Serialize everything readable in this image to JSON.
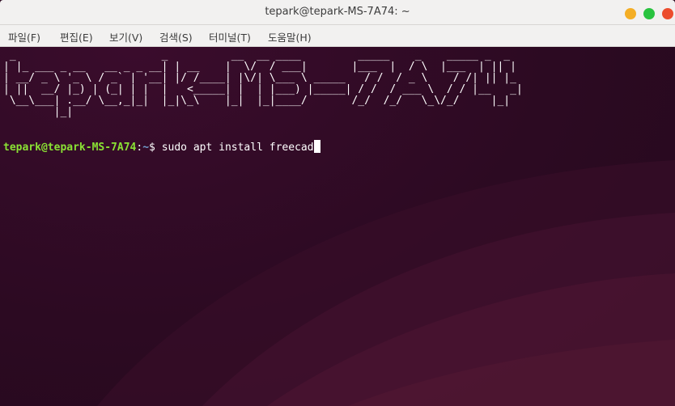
{
  "window": {
    "title": "tepark@tepark-MS-7A74: ~",
    "buttons": {
      "minimize_color": "#f4ae25",
      "maximize_color": "#29c33f",
      "close_color": "#ec4d2d"
    }
  },
  "menubar": {
    "items": [
      {
        "label": "파일(F)"
      },
      {
        "label": "편집(E)"
      },
      {
        "label": "보기(V)"
      },
      {
        "label": "검색(S)"
      },
      {
        "label": "터미널(T)"
      },
      {
        "label": "도움말(H)"
      }
    ]
  },
  "terminal": {
    "background_color": "#2c0a22",
    "ascii_banner": " _                       _          __  __ ____         _____    _    _____ _  _\n| |_ ___ _ __   __ _ _ __| | __    |  \\/  / ___|       |___  |  / \\  |___  | || |\n| __/ _ \\ '_ \\ / _` | '__| |/ /____| |\\/| \\___ \\ _____   / /  / _ \\    / /| || |_\n| ||  __/ |_) | (_| | |  |   <_____| |  | |___) |_____| / /  / ___ \\  / / |__   _|\n \\__\\___| .__/ \\__,_|_|  |_|\\_\\    |_|  |_|____/       /_/  /_/   \\_\\/_/     |_|\n        |_|",
    "prompt": {
      "user_host": "tepark@tepark-MS-7A74",
      "separator": ":",
      "path": "~",
      "symbol": "$ ",
      "command": "sudo apt install freecad"
    },
    "colors": {
      "user_host": "#8ae234",
      "path": "#729fcf",
      "text": "#ffffff"
    }
  }
}
